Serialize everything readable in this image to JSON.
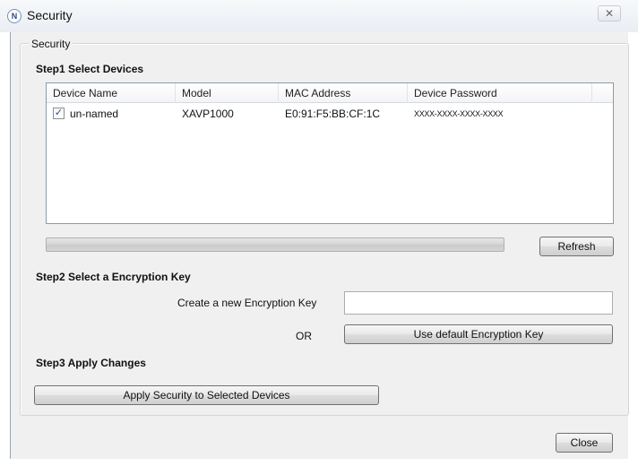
{
  "window": {
    "title": "Security",
    "icon_letter": "N",
    "close_glyph": "✕"
  },
  "group": {
    "label": "Security"
  },
  "step1": {
    "heading": "Step1  Select Devices",
    "columns": [
      "Device Name",
      "Model",
      "MAC Address",
      "Device Password"
    ],
    "rows": [
      {
        "checked": true,
        "device_name": "un-named",
        "model": "XAVP1000",
        "mac_address": "E0:91:F5:BB:CF:1C",
        "device_password": "XXXX-XXXX-XXXX-XXXX"
      }
    ],
    "progress_percent": 0,
    "refresh_label": "Refresh"
  },
  "step2": {
    "heading": "Step2  Select a Encryption Key",
    "new_key_label": "Create a new Encryption Key",
    "new_key_value": "",
    "or_label": "OR",
    "default_key_label": "Use default Encryption Key"
  },
  "step3": {
    "heading": "Step3  Apply Changes",
    "apply_label": "Apply Security to Selected Devices"
  },
  "footer": {
    "close_label": "Close"
  },
  "colors": {
    "dialog_background": "#f0f0f0",
    "button_border": "#707070"
  }
}
